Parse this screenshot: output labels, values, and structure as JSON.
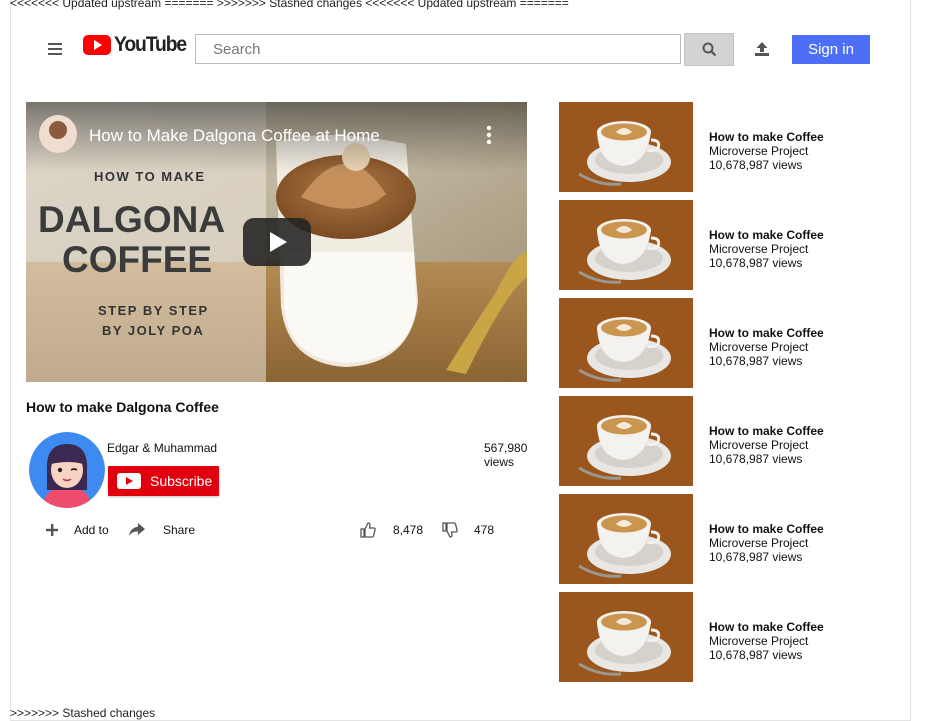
{
  "conflict_markers": {
    "top": "<<<<<<< Updated upstream ======= >>>>>>> Stashed changes <<<<<<< Updated upstream =======",
    "bottom": ">>>>>>> Stashed changes"
  },
  "header": {
    "logo_text": "YouTube",
    "search_placeholder": "Search",
    "signin_label": "Sign in"
  },
  "player": {
    "overlay_title": "How to Make Dalgona Coffee at Home",
    "thumb_line1": "HOW TO MAKE",
    "thumb_line2": "DALGONA",
    "thumb_line3": "COFFEE",
    "thumb_line4": "STEP BY STEP",
    "thumb_line5": "BY JOLY POA"
  },
  "video": {
    "title": "How to make Dalgona Coffee",
    "channel": "Edgar & Muhammad",
    "subscribe_label": "Subscribe",
    "views": "567,980 views",
    "add_to_label": "Add to",
    "share_label": "Share",
    "likes": "8,478",
    "dislikes": "478"
  },
  "related": [
    {
      "title": "How to make Coffee",
      "channel": "Microverse Project",
      "views": "10,678,987 views"
    },
    {
      "title": "How to make Coffee",
      "channel": "Microverse Project",
      "views": "10,678,987 views"
    },
    {
      "title": "How to make Coffee",
      "channel": "Microverse Project",
      "views": "10,678,987 views"
    },
    {
      "title": "How to make Coffee",
      "channel": "Microverse Project",
      "views": "10,678,987 views"
    },
    {
      "title": "How to make Coffee",
      "channel": "Microverse Project",
      "views": "10,678,987 views"
    },
    {
      "title": "How to make Coffee",
      "channel": "Microverse Project",
      "views": "10,678,987 views"
    }
  ],
  "colors": {
    "brand_red": "#ff0000",
    "subscribe_red": "#e1000d",
    "signin_blue": "#4f6ef7"
  },
  "icons": {
    "menu": "hamburger-icon",
    "search": "search-icon",
    "upload": "upload-icon",
    "play": "play-icon",
    "more": "more-vertical-icon",
    "add": "plus-icon",
    "share": "share-icon",
    "like": "thumbs-up-icon",
    "dislike": "thumbs-down-icon"
  }
}
